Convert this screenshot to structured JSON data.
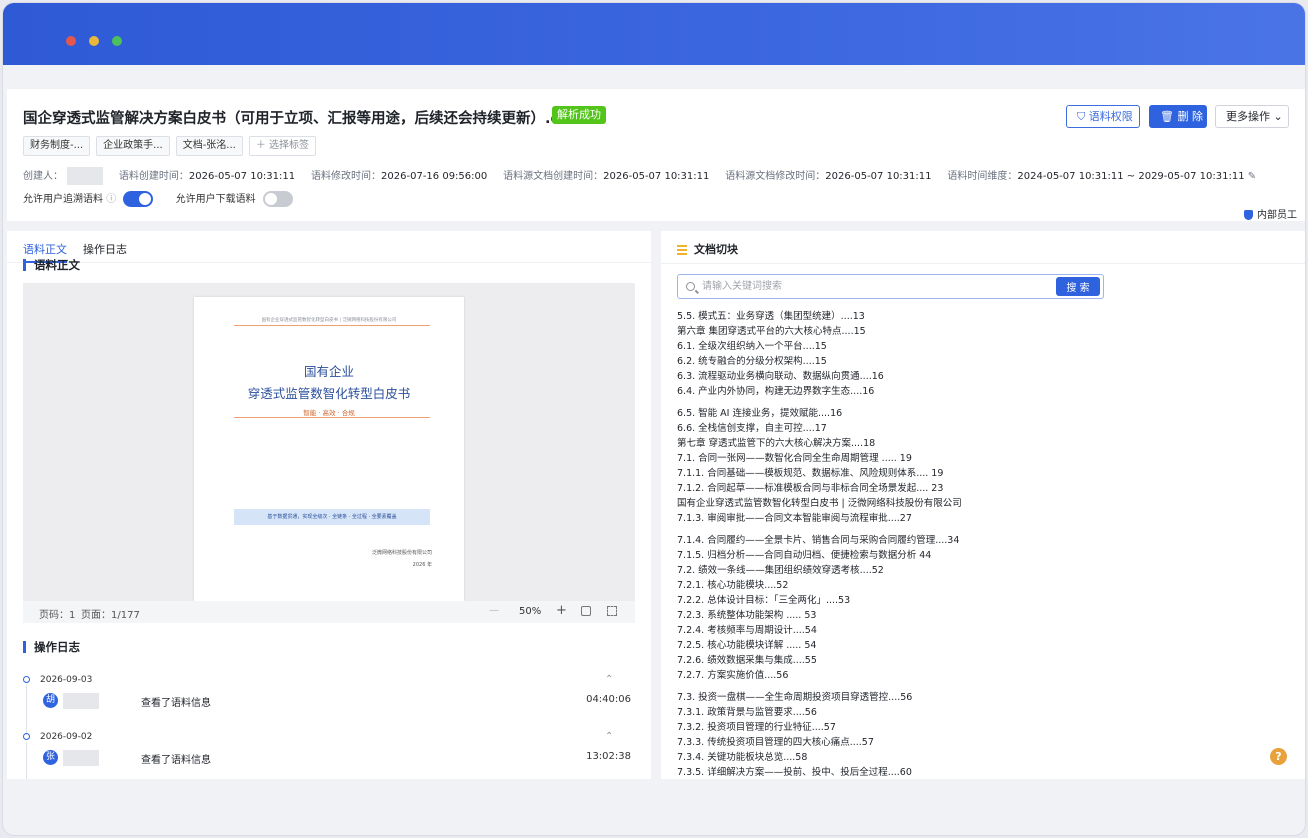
{
  "document": {
    "title": "国企穿透式监管解决方案白皮书（可用于立项、汇报等用途，后续还会持续更新）.docx",
    "status_badge": "解析成功"
  },
  "actions": {
    "permission": "语料权限",
    "delete": "删 除",
    "more": "更多操作"
  },
  "tags": [
    "财务制度-...",
    "企业政策手...",
    "文档-张洺..."
  ],
  "add_tag": "选择标签",
  "meta": {
    "creator_label": "创建人：",
    "created_label": "语料创建时间：",
    "created": "2026-05-07 10:31:11",
    "modified_label": "语料修改时间：",
    "modified": "2026-07-16 09:56:00",
    "src_created_label": "语料源文档创建时间：",
    "src_created": "2026-05-07 10:31:11",
    "src_modified_label": "语料源文档修改时间：",
    "src_modified": "2026-05-07 10:31:11",
    "dimension_label": "语料时间维度：",
    "dimension": "2024-05-07 10:31:11 ~ 2029-05-07 10:31:11"
  },
  "toggles": {
    "trace_label": "允许用户追溯语料",
    "trace_on": true,
    "download_label": "允许用户下载语料",
    "download_on": false
  },
  "staff_badge": "内部员工",
  "left": {
    "tab_body": "语料正文",
    "tab_log": "操作日志",
    "section_body": "语料正文",
    "section_log": "操作日志"
  },
  "preview": {
    "header": "国有企业穿透式监管数智化转型白皮书  |  泛微网络科技股份有限公司",
    "title_line1": "国有企业",
    "title_line2": "穿透式监管数智化转型白皮书",
    "subtitle": "智能 · 高效 · 合规",
    "band": "基于数据贯通，实现全级次 · 全链条 · 全过程 · 全要素覆盖",
    "company": "泛微网络科技股份有限公司",
    "year": "2026 年"
  },
  "viewer": {
    "page": "页码：1",
    "total": "页面：1/177",
    "zoom": "50%"
  },
  "logs": [
    {
      "date": "2026-09-03",
      "avatar": "胡",
      "action": "查看了语料信息",
      "time": "04:40:06"
    },
    {
      "date": "2026-09-02",
      "avatar": "张",
      "action": "查看了语料信息",
      "time": "13:02:38"
    }
  ],
  "right": {
    "title": "文档切块",
    "search_placeholder": "请输入关键词搜索",
    "search_button": "搜 索"
  },
  "toc_groups": [
    [
      "5.5. 模式五：业务穿透（集团型统建）....13",
      "第六章 集团穿透式平台的六大核心特点....15",
      "6.1. 全级次组织纳入一个平台....15",
      "6.2. 统专融合的分级分权架构....15",
      "6.3. 流程驱动业务横向联动、数据纵向贯通....16",
      "6.4. 产业内外协同，构建无边界数字生态....16"
    ],
    [
      "6.5. 智能 AI 连接业务，提效赋能....16",
      "6.6. 全栈信创支撑，自主可控....17",
      "第七章 穿透式监管下的六大核心解决方案....18",
      "7.1. 合同一张网——数智化合同全生命周期管理 ..... 19",
      "7.1.1. 合同基础——模板规范、数据标准、风险规则体系.... 19",
      "7.1.2. 合同起草——标准模板合同与非标合同全场景发起.... 23",
      "国有企业穿透式监管数智化转型白皮书 | 泛微网络科技股份有限公司",
      "7.1.3. 审阅审批——合同文本智能审阅与流程审批....27"
    ],
    [
      "7.1.4. 合同履约——全景卡片、销售合同与采购合同履约管理....34",
      "7.1.5. 归档分析——合同自动归档、便捷检索与数据分析 44",
      "7.2. 绩效一条线——集团组织绩效穿透考核....52",
      "7.2.1. 核心功能模块....52",
      "7.2.2. 总体设计目标：「三全两化」....53",
      "7.2.3. 系统整体功能架构 ..... 53",
      "7.2.4. 考核频率与周期设计....54",
      "7.2.5. 核心功能模块详解 ..... 54",
      "7.2.6. 绩效数据采集与集成....55",
      "7.2.7. 方案实施价值....56"
    ],
    [
      "7.3. 投资一盘棋——全生命周期投资项目穿透管控....56",
      "7.3.1. 政策背景与监管要求....56",
      "7.3.2. 投资项目管理的行业特征....57",
      "7.3.3. 传统投资项目管理的四大核心痛点....57",
      "7.3.4. 关键功能板块总览....58",
      "7.3.5. 详细解决方案——投前、投中、投后全过程....60"
    ]
  ],
  "help": "?"
}
